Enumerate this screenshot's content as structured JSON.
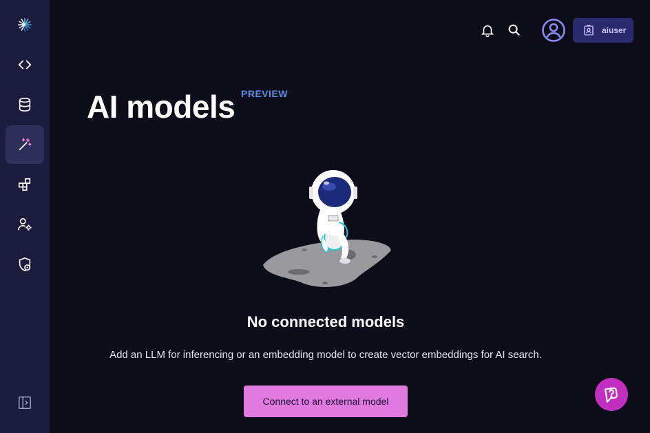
{
  "sidebar": {
    "items": [
      {
        "name": "logo-icon"
      },
      {
        "name": "code-icon"
      },
      {
        "name": "database-icon"
      },
      {
        "name": "magic-wand-icon",
        "active": true
      },
      {
        "name": "blocks-icon"
      },
      {
        "name": "user-settings-icon"
      },
      {
        "name": "shield-icon"
      }
    ],
    "collapse_icon": "sidebar-collapse-icon"
  },
  "topbar": {
    "icons": [
      "bell-icon",
      "search-icon",
      "account-circle-icon"
    ],
    "user": {
      "label": "aiuser",
      "icon": "badge-icon"
    }
  },
  "page": {
    "title": "AI models",
    "tag": "PREVIEW"
  },
  "empty_state": {
    "title": "No connected models",
    "description": "Add an LLM for inferencing or an embedding model to create vector embeddings for AI search.",
    "button_label": "Connect to an external model"
  },
  "colors": {
    "sidebar_bg": "#1a1b3d",
    "main_bg": "#0d0d1a",
    "accent_button": "#e07ae0",
    "help_fab": "#c12ec0",
    "preview_tag": "#5b8fe8",
    "user_button_bg": "#2a2a6e"
  },
  "help": {
    "icon": "help-chat-icon"
  }
}
